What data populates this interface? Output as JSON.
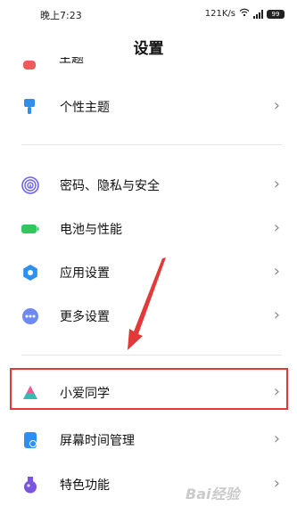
{
  "status_bar": {
    "time": "晚上7:23",
    "network_speed": "121K/s",
    "battery": "99"
  },
  "header": {
    "title": "设置"
  },
  "partial_item": {
    "label": "主题",
    "icon": "red-app-icon"
  },
  "items": [
    {
      "label": "个性主题",
      "icon": "paint-brush-icon",
      "color": "#2e8ff0"
    },
    {
      "label": "密码、隐私与安全",
      "icon": "fingerprint-icon",
      "color": "#6c63f0"
    },
    {
      "label": "电池与性能",
      "icon": "battery-icon",
      "color": "#2fc75e"
    },
    {
      "label": "应用设置",
      "icon": "gear-icon",
      "color": "#2e8ff0"
    },
    {
      "label": "更多设置",
      "icon": "more-dots-icon",
      "color": "#6f89f2"
    },
    {
      "label": "小爱同学",
      "icon": "xiaoai-icon",
      "color": "#4a7cf0"
    },
    {
      "label": "屏幕时间管理",
      "icon": "hourglass-icon",
      "color": "#2e8ff0"
    },
    {
      "label": "特色功能",
      "icon": "potion-icon",
      "color": "#7a55e0"
    }
  ],
  "annotation": {
    "highlight_color": "#e23a3a"
  },
  "watermark": {
    "text": "Bai经验"
  }
}
